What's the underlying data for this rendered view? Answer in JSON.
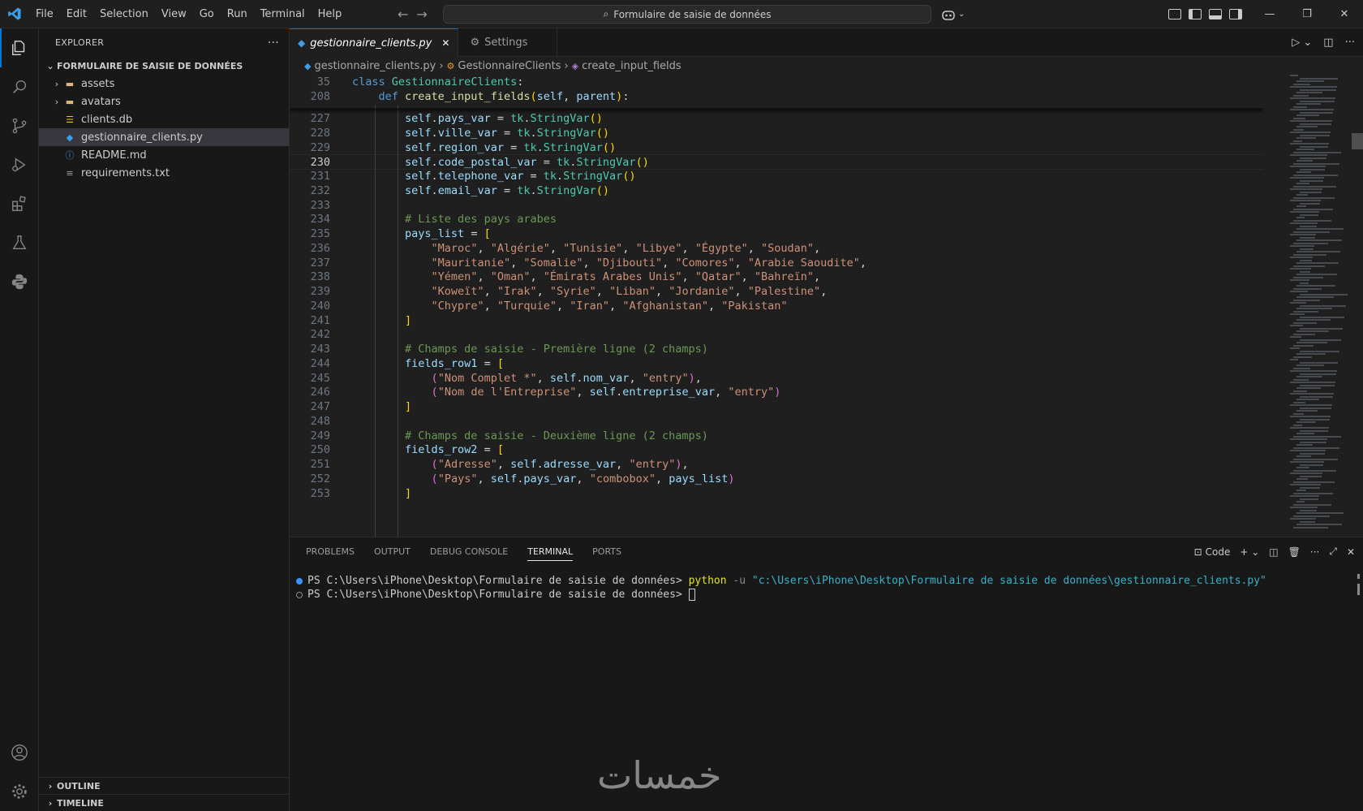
{
  "titlebar": {
    "menu": [
      "File",
      "Edit",
      "Selection",
      "View",
      "Go",
      "Run",
      "Terminal",
      "Help"
    ],
    "search_text": "Formulaire de saisie de données"
  },
  "sidebar": {
    "title": "EXPLORER",
    "folder": "FORMULAIRE DE SAISIE DE DONNÉES",
    "items": [
      {
        "label": "assets",
        "type": "folder"
      },
      {
        "label": "avatars",
        "type": "folder"
      },
      {
        "label": "clients.db",
        "type": "db"
      },
      {
        "label": "gestionnaire_clients.py",
        "type": "python",
        "selected": true
      },
      {
        "label": "README.md",
        "type": "info"
      },
      {
        "label": "requirements.txt",
        "type": "text"
      }
    ],
    "outline": "OUTLINE",
    "timeline": "TIMELINE"
  },
  "editor": {
    "tabs": [
      {
        "label": "gestionnaire_clients.py",
        "active": true
      },
      {
        "label": "Settings",
        "active": false
      }
    ],
    "breadcrumb": [
      "gestionnaire_clients.py",
      "GestionnaireClients",
      "create_input_fields"
    ],
    "sticky": [
      {
        "num": "35",
        "tokens": [
          [
            "k",
            "class "
          ],
          [
            "cls",
            "GestionnaireClients"
          ],
          [
            "p",
            ":"
          ]
        ]
      },
      {
        "num": "208",
        "tokens": [
          [
            "p",
            "    "
          ],
          [
            "k",
            "def "
          ],
          [
            "fn",
            "create_input_fields"
          ],
          [
            "b1",
            "("
          ],
          [
            "sf",
            "self"
          ],
          [
            "p",
            ", "
          ],
          [
            "sf",
            "parent"
          ],
          [
            "b1",
            ")"
          ],
          [
            "p",
            ":"
          ]
        ]
      }
    ],
    "lines": [
      {
        "num": "227",
        "tokens": [
          [
            "p",
            "        "
          ],
          [
            "sf",
            "self"
          ],
          [
            "p",
            "."
          ],
          [
            "sf",
            "pays_var"
          ],
          [
            "p",
            " = "
          ],
          [
            "cls",
            "tk"
          ],
          [
            "p",
            "."
          ],
          [
            "cls",
            "StringVar"
          ],
          [
            "b1",
            "()"
          ]
        ]
      },
      {
        "num": "228",
        "tokens": [
          [
            "p",
            "        "
          ],
          [
            "sf",
            "self"
          ],
          [
            "p",
            "."
          ],
          [
            "sf",
            "ville_var"
          ],
          [
            "p",
            " = "
          ],
          [
            "cls",
            "tk"
          ],
          [
            "p",
            "."
          ],
          [
            "cls",
            "StringVar"
          ],
          [
            "b1",
            "()"
          ]
        ]
      },
      {
        "num": "229",
        "tokens": [
          [
            "p",
            "        "
          ],
          [
            "sf",
            "self"
          ],
          [
            "p",
            "."
          ],
          [
            "sf",
            "region_var"
          ],
          [
            "p",
            " = "
          ],
          [
            "cls",
            "tk"
          ],
          [
            "p",
            "."
          ],
          [
            "cls",
            "StringVar"
          ],
          [
            "b1",
            "()"
          ]
        ]
      },
      {
        "num": "230",
        "current": true,
        "tokens": [
          [
            "p",
            "        "
          ],
          [
            "sf",
            "self"
          ],
          [
            "p",
            "."
          ],
          [
            "sf",
            "code_postal_var"
          ],
          [
            "p",
            " = "
          ],
          [
            "cls",
            "tk"
          ],
          [
            "p",
            "."
          ],
          [
            "cls",
            "StringVar"
          ],
          [
            "b1",
            "()"
          ]
        ]
      },
      {
        "num": "231",
        "tokens": [
          [
            "p",
            "        "
          ],
          [
            "sf",
            "self"
          ],
          [
            "p",
            "."
          ],
          [
            "sf",
            "telephone_var"
          ],
          [
            "p",
            " = "
          ],
          [
            "cls",
            "tk"
          ],
          [
            "p",
            "."
          ],
          [
            "cls",
            "StringVar"
          ],
          [
            "b1",
            "()"
          ]
        ]
      },
      {
        "num": "232",
        "tokens": [
          [
            "p",
            "        "
          ],
          [
            "sf",
            "self"
          ],
          [
            "p",
            "."
          ],
          [
            "sf",
            "email_var"
          ],
          [
            "p",
            " = "
          ],
          [
            "cls",
            "tk"
          ],
          [
            "p",
            "."
          ],
          [
            "cls",
            "StringVar"
          ],
          [
            "b1",
            "()"
          ]
        ]
      },
      {
        "num": "233",
        "tokens": []
      },
      {
        "num": "234",
        "tokens": [
          [
            "p",
            "        "
          ],
          [
            "c",
            "# Liste des pays arabes"
          ]
        ]
      },
      {
        "num": "235",
        "tokens": [
          [
            "p",
            "        "
          ],
          [
            "sf",
            "pays_list"
          ],
          [
            "p",
            " = "
          ],
          [
            "b1",
            "["
          ]
        ]
      },
      {
        "num": "236",
        "tokens": [
          [
            "p",
            "            "
          ],
          [
            "s",
            "\"Maroc\""
          ],
          [
            "p",
            ", "
          ],
          [
            "s",
            "\"Algérie\""
          ],
          [
            "p",
            ", "
          ],
          [
            "s",
            "\"Tunisie\""
          ],
          [
            "p",
            ", "
          ],
          [
            "s",
            "\"Libye\""
          ],
          [
            "p",
            ", "
          ],
          [
            "s",
            "\"Égypte\""
          ],
          [
            "p",
            ", "
          ],
          [
            "s",
            "\"Soudan\""
          ],
          [
            "p",
            ","
          ]
        ]
      },
      {
        "num": "237",
        "tokens": [
          [
            "p",
            "            "
          ],
          [
            "s",
            "\"Mauritanie\""
          ],
          [
            "p",
            ", "
          ],
          [
            "s",
            "\"Somalie\""
          ],
          [
            "p",
            ", "
          ],
          [
            "s",
            "\"Djibouti\""
          ],
          [
            "p",
            ", "
          ],
          [
            "s",
            "\"Comores\""
          ],
          [
            "p",
            ", "
          ],
          [
            "s",
            "\"Arabie Saoudite\""
          ],
          [
            "p",
            ","
          ]
        ]
      },
      {
        "num": "238",
        "tokens": [
          [
            "p",
            "            "
          ],
          [
            "s",
            "\"Yémen\""
          ],
          [
            "p",
            ", "
          ],
          [
            "s",
            "\"Oman\""
          ],
          [
            "p",
            ", "
          ],
          [
            "s",
            "\"Émirats Arabes Unis\""
          ],
          [
            "p",
            ", "
          ],
          [
            "s",
            "\"Qatar\""
          ],
          [
            "p",
            ", "
          ],
          [
            "s",
            "\"Bahreïn\""
          ],
          [
            "p",
            ","
          ]
        ]
      },
      {
        "num": "239",
        "tokens": [
          [
            "p",
            "            "
          ],
          [
            "s",
            "\"Koweït\""
          ],
          [
            "p",
            ", "
          ],
          [
            "s",
            "\"Irak\""
          ],
          [
            "p",
            ", "
          ],
          [
            "s",
            "\"Syrie\""
          ],
          [
            "p",
            ", "
          ],
          [
            "s",
            "\"Liban\""
          ],
          [
            "p",
            ", "
          ],
          [
            "s",
            "\"Jordanie\""
          ],
          [
            "p",
            ", "
          ],
          [
            "s",
            "\"Palestine\""
          ],
          [
            "p",
            ","
          ]
        ]
      },
      {
        "num": "240",
        "tokens": [
          [
            "p",
            "            "
          ],
          [
            "s",
            "\"Chypre\""
          ],
          [
            "p",
            ", "
          ],
          [
            "s",
            "\"Turquie\""
          ],
          [
            "p",
            ", "
          ],
          [
            "s",
            "\"Iran\""
          ],
          [
            "p",
            ", "
          ],
          [
            "s",
            "\"Afghanistan\""
          ],
          [
            "p",
            ", "
          ],
          [
            "s",
            "\"Pakistan\""
          ]
        ]
      },
      {
        "num": "241",
        "tokens": [
          [
            "p",
            "        "
          ],
          [
            "b1",
            "]"
          ]
        ]
      },
      {
        "num": "242",
        "tokens": []
      },
      {
        "num": "243",
        "tokens": [
          [
            "p",
            "        "
          ],
          [
            "c",
            "# Champs de saisie - Première ligne (2 champs)"
          ]
        ]
      },
      {
        "num": "244",
        "tokens": [
          [
            "p",
            "        "
          ],
          [
            "sf",
            "fields_row1"
          ],
          [
            "p",
            " = "
          ],
          [
            "b1",
            "["
          ]
        ]
      },
      {
        "num": "245",
        "tokens": [
          [
            "p",
            "            "
          ],
          [
            "b2",
            "("
          ],
          [
            "s",
            "\"Nom Complet *\""
          ],
          [
            "p",
            ", "
          ],
          [
            "sf",
            "self"
          ],
          [
            "p",
            "."
          ],
          [
            "sf",
            "nom_var"
          ],
          [
            "p",
            ", "
          ],
          [
            "s",
            "\"entry\""
          ],
          [
            "b2",
            ")"
          ],
          [
            "p",
            ","
          ]
        ]
      },
      {
        "num": "246",
        "tokens": [
          [
            "p",
            "            "
          ],
          [
            "b2",
            "("
          ],
          [
            "s",
            "\"Nom de l'Entreprise\""
          ],
          [
            "p",
            ", "
          ],
          [
            "sf",
            "self"
          ],
          [
            "p",
            "."
          ],
          [
            "sf",
            "entreprise_var"
          ],
          [
            "p",
            ", "
          ],
          [
            "s",
            "\"entry\""
          ],
          [
            "b2",
            ")"
          ]
        ]
      },
      {
        "num": "247",
        "tokens": [
          [
            "p",
            "        "
          ],
          [
            "b1",
            "]"
          ]
        ]
      },
      {
        "num": "248",
        "tokens": []
      },
      {
        "num": "249",
        "tokens": [
          [
            "p",
            "        "
          ],
          [
            "c",
            "# Champs de saisie - Deuxième ligne (2 champs)"
          ]
        ]
      },
      {
        "num": "250",
        "tokens": [
          [
            "p",
            "        "
          ],
          [
            "sf",
            "fields_row2"
          ],
          [
            "p",
            " = "
          ],
          [
            "b1",
            "["
          ]
        ]
      },
      {
        "num": "251",
        "tokens": [
          [
            "p",
            "            "
          ],
          [
            "b2",
            "("
          ],
          [
            "s",
            "\"Adresse\""
          ],
          [
            "p",
            ", "
          ],
          [
            "sf",
            "self"
          ],
          [
            "p",
            "."
          ],
          [
            "sf",
            "adresse_var"
          ],
          [
            "p",
            ", "
          ],
          [
            "s",
            "\"entry\""
          ],
          [
            "b2",
            ")"
          ],
          [
            "p",
            ","
          ]
        ]
      },
      {
        "num": "252",
        "tokens": [
          [
            "p",
            "            "
          ],
          [
            "b2",
            "("
          ],
          [
            "s",
            "\"Pays\""
          ],
          [
            "p",
            ", "
          ],
          [
            "sf",
            "self"
          ],
          [
            "p",
            "."
          ],
          [
            "sf",
            "pays_var"
          ],
          [
            "p",
            ", "
          ],
          [
            "s",
            "\"combobox\""
          ],
          [
            "p",
            ", "
          ],
          [
            "sf",
            "pays_list"
          ],
          [
            "b2",
            ")"
          ]
        ]
      },
      {
        "num": "253",
        "tokens": [
          [
            "p",
            "        "
          ],
          [
            "b1",
            "]"
          ]
        ]
      }
    ]
  },
  "panel": {
    "tabs": [
      "PROBLEMS",
      "OUTPUT",
      "DEBUG CONSOLE",
      "TERMINAL",
      "PORTS"
    ],
    "active_tab": "TERMINAL",
    "shell_label": "Code",
    "terminal": {
      "prompt": "PS C:\\Users\\iPhone\\Desktop\\Formulaire de saisie de données> ",
      "command": "python",
      "flag": " -u ",
      "arg": "\"c:\\Users\\iPhone\\Desktop\\Formulaire de saisie de données\\gestionnaire_clients.py\""
    }
  },
  "watermark": "خمسات",
  "colors": {
    "accent": "#0078d4",
    "background": "#1f1f1f",
    "sidebar": "#181818"
  }
}
